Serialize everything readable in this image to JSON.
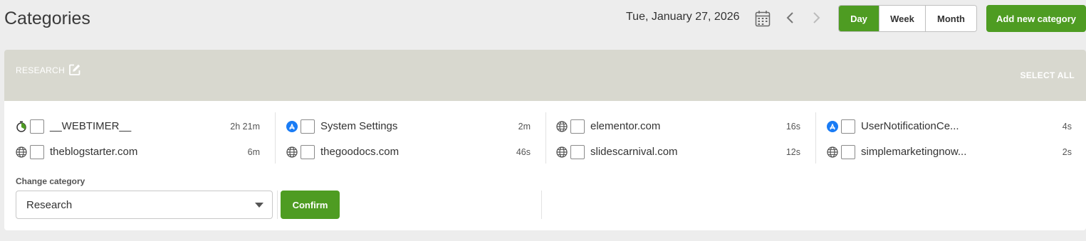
{
  "header": {
    "title": "Categories",
    "date": "Tue, January 27, 2026",
    "view_tabs": [
      {
        "label": "Day",
        "active": true
      },
      {
        "label": "Week",
        "active": false
      },
      {
        "label": "Month",
        "active": false
      }
    ],
    "add_button": "Add new category"
  },
  "category": {
    "name": "RESEARCH",
    "select_all": "SELECT ALL",
    "columns": [
      [
        {
          "icon": "timer-icon",
          "name": "__WEBTIMER__",
          "time": "2h 21m"
        },
        {
          "icon": "globe-icon",
          "name": "theblogstarter.com",
          "time": "6m"
        }
      ],
      [
        {
          "icon": "app-store-icon",
          "name": "System Settings",
          "time": "2m"
        },
        {
          "icon": "globe-icon",
          "name": "thegoodocs.com",
          "time": "46s"
        }
      ],
      [
        {
          "icon": "globe-icon",
          "name": "elementor.com",
          "time": "16s"
        },
        {
          "icon": "globe-icon",
          "name": "slidescarnival.com",
          "time": "12s"
        }
      ],
      [
        {
          "icon": "app-store-icon",
          "name": "UserNotificationCe...",
          "time": "4s"
        },
        {
          "icon": "globe-icon",
          "name": "simplemarketingnow...",
          "time": "2s"
        }
      ]
    ],
    "change_label": "Change category",
    "selected_category": "Research",
    "confirm_label": "Confirm"
  },
  "colors": {
    "accent": "#4e9c22",
    "header_band": "#d8d8cf",
    "app_store_blue": "#1a7cf5"
  }
}
